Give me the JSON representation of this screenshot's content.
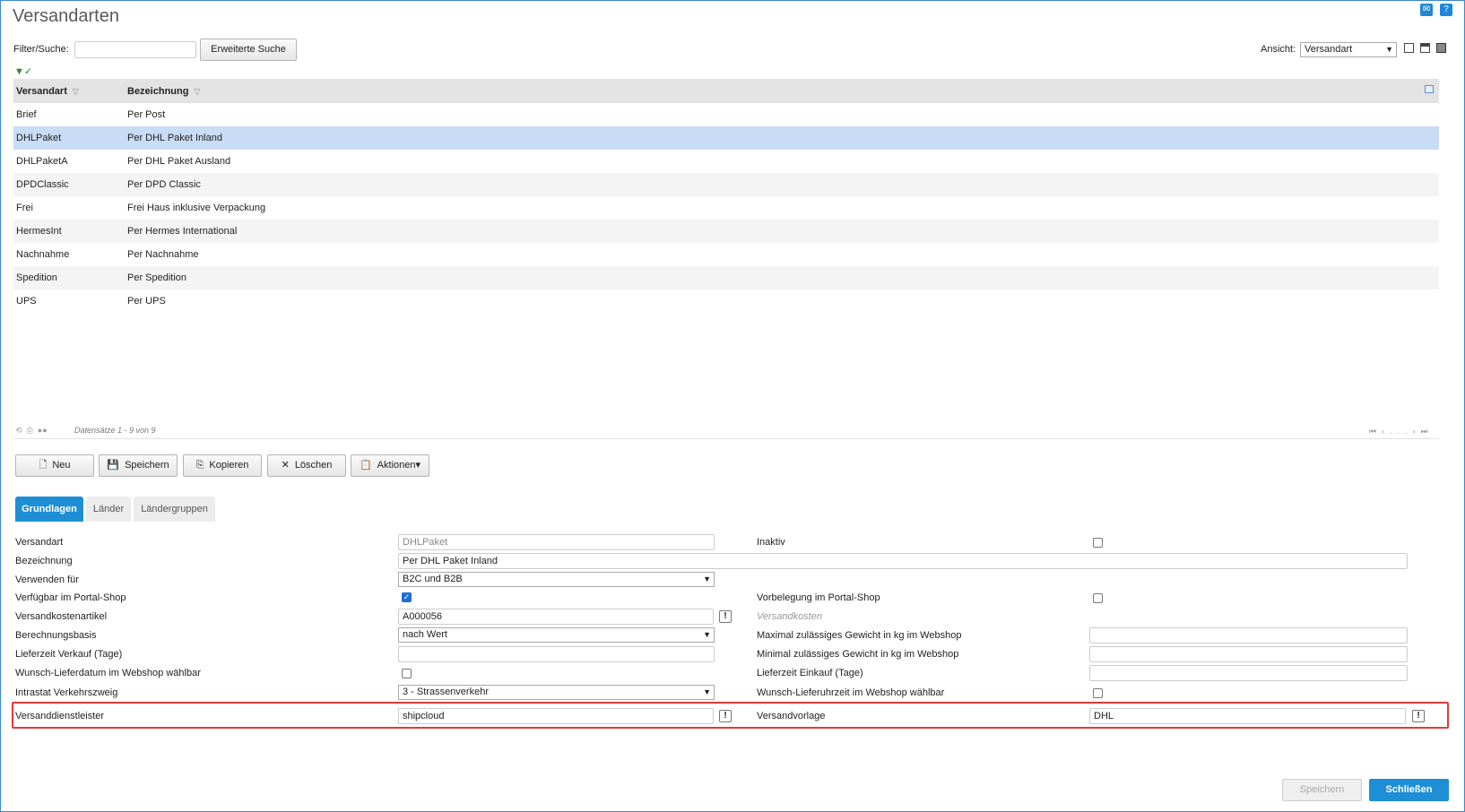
{
  "title": "Versandarten",
  "filter": {
    "label": "Filter/Suche:",
    "value": "",
    "advanced_button": "Erweiterte Suche"
  },
  "view": {
    "label": "Ansicht:",
    "selected": "Versandart"
  },
  "grid": {
    "columns": [
      "Versandart",
      "Bezeichnung"
    ],
    "rows": [
      [
        "Brief",
        "Per Post"
      ],
      [
        "DHLPaket",
        "Per DHL Paket Inland"
      ],
      [
        "DHLPaketA",
        "Per DHL Paket Ausland"
      ],
      [
        "DPDClassic",
        "Per DPD Classic"
      ],
      [
        "Frei",
        "Frei Haus inklusive Verpackung"
      ],
      [
        "HermesInt",
        "Per Hermes International"
      ],
      [
        "Nachnahme",
        "Per Nachnahme"
      ],
      [
        "Spedition",
        "Per Spedition"
      ],
      [
        "UPS",
        "Per UPS"
      ]
    ],
    "selected_row": 1
  },
  "pager": {
    "text": "Datensätze 1 - 9 von 9",
    "dots": "..."
  },
  "actions": {
    "new": "Neu",
    "save": "Speichern",
    "copy": "Kopieren",
    "delete": "Löschen",
    "more": "Aktionen"
  },
  "tabs": [
    "Grundlagen",
    "Länder",
    "Ländergruppen"
  ],
  "form": {
    "versandart": {
      "label": "Versandart",
      "value": "DHLPaket"
    },
    "inaktiv": {
      "label": "Inaktiv",
      "checked": false
    },
    "bezeichnung": {
      "label": "Bezeichnung",
      "value": "Per DHL Paket Inland"
    },
    "verwenden": {
      "label": "Verwenden für",
      "value": "B2C und B2B"
    },
    "portal_shop": {
      "label": "Verfügbar im Portal-Shop",
      "checked": true
    },
    "vorbelegung": {
      "label": "Vorbelegung im Portal-Shop",
      "checked": false
    },
    "kostenartikel": {
      "label": "Versandkostenartikel",
      "value": "A000056"
    },
    "versandkosten": {
      "label": "Versandkosten"
    },
    "berechnungsbasis": {
      "label": "Berechnungsbasis",
      "value": "nach Wert"
    },
    "max_gewicht": {
      "label": "Maximal zulässiges Gewicht in kg im Webshop",
      "value": ""
    },
    "lieferzeit_verkauf": {
      "label": "Lieferzeit Verkauf (Tage)",
      "value": ""
    },
    "min_gewicht": {
      "label": "Minimal zulässiges Gewicht in kg im Webshop",
      "value": ""
    },
    "wunsch_lieferdatum": {
      "label": "Wunsch-Lieferdatum im Webshop wählbar",
      "checked": false
    },
    "lieferzeit_einkauf": {
      "label": "Lieferzeit Einkauf (Tage)",
      "value": ""
    },
    "intrastat": {
      "label": "Intrastat Verkehrszweig",
      "value": "3 - Strassenverkehr"
    },
    "wunsch_lieferuhrzeit": {
      "label": "Wunsch-Lieferuhrzeit im Webshop wählbar",
      "checked": false
    },
    "dienstleister": {
      "label": "Versanddienstleister",
      "value": "shipcloud"
    },
    "vorlage": {
      "label": "Versandvorlage",
      "value": "DHL"
    }
  },
  "footer": {
    "save": "Speichern",
    "close": "Schließen"
  },
  "colors": {
    "accent": "#1e8fd6",
    "selected_row": "#c8dcf5",
    "highlight": "#e23a3a"
  }
}
